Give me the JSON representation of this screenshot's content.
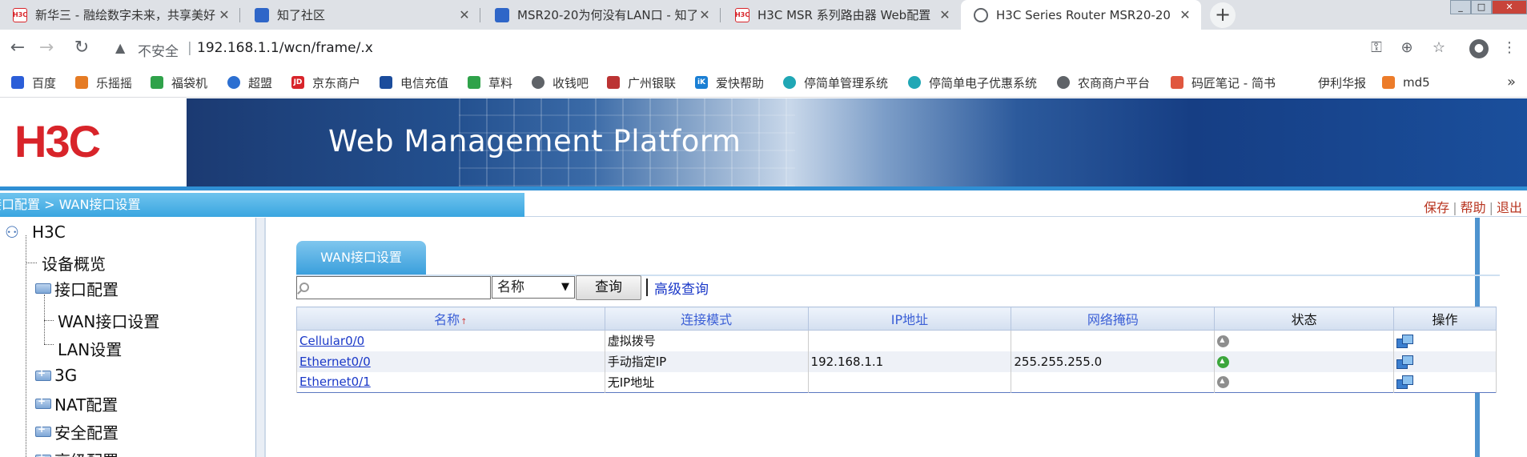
{
  "browser": {
    "tabs": [
      {
        "title": "新华三 - 融绘数字未来，共享美好",
        "fav": "H3C",
        "fav_color": "#d8242a"
      },
      {
        "title": "知了社区",
        "fav": "",
        "fav_color": "#2f66c8"
      },
      {
        "title": "MSR20-20为何没有LAN口 - 知了",
        "fav": "",
        "fav_color": "#2f66c8"
      },
      {
        "title": "H3C MSR 系列路由器 Web配置",
        "fav": "H3C",
        "fav_color": "#d8242a"
      },
      {
        "title": "H3C Series Router MSR20-20",
        "fav": "",
        "fav_color": "#5f6368"
      }
    ],
    "new_tab": "+",
    "window_controls": {
      "minimize": "_",
      "maximize": "□",
      "close": "✕"
    }
  },
  "address_bar": {
    "back": "←",
    "forward": "→",
    "reload": "↻",
    "warning": "▲",
    "security": "不安全",
    "separator": "|",
    "url": "192.168.1.1/wcn/frame/.x",
    "icons": [
      "key-icon",
      "zoom-icon",
      "star-icon",
      "profile-icon",
      "menu-icon"
    ]
  },
  "bookmarks": [
    {
      "label": "百度",
      "color": "#2b5ed8"
    },
    {
      "label": "乐摇摇",
      "color": "#e57b24"
    },
    {
      "label": "福袋机",
      "color": "#2fa24a"
    },
    {
      "label": "超盟",
      "color": "#2c6fd1"
    },
    {
      "label": "京东商户",
      "color": "#d8242a"
    },
    {
      "label": "电信充值",
      "color": "#1b4c9c"
    },
    {
      "label": "草料",
      "color": "#2fa24a"
    },
    {
      "label": "收钱吧",
      "color": "#5f6368"
    },
    {
      "label": "广州银联",
      "color": "#b33"
    },
    {
      "label": "爱快帮助",
      "color": "#1a7fd4"
    },
    {
      "label": "停简单管理系统",
      "color": "#20a7b5"
    },
    {
      "label": "停简单电子优惠系统",
      "color": "#20a7b5"
    },
    {
      "label": "农商商户平台",
      "color": "#5f6368"
    },
    {
      "label": "码匠笔记 - 简书",
      "color": "#e0573f"
    },
    {
      "label": "伊利华报",
      "color": "#ffffff"
    },
    {
      "label": "md5",
      "color": "#ec7c2a"
    }
  ],
  "bookmarks_more": "»",
  "router": {
    "logo": "H3C",
    "platform_title": "Web Management Platform",
    "breadcrumb": "接口配置 > WAN接口设置",
    "top_links": {
      "save": "保存",
      "help": "帮助",
      "logout": "退出"
    },
    "nav": {
      "root": "H3C",
      "overview": "设备概览",
      "interface_config": "接口配置",
      "wan": "WAN接口设置",
      "lan": "LAN设置",
      "g3": "3G",
      "nat": "NAT配置",
      "security": "安全配置",
      "advanced": "高级配置"
    },
    "panel_tab": "WAN接口设置",
    "search": {
      "placeholder": "",
      "field_selected": "名称",
      "query_button": "查询",
      "advanced_link": "高级查询"
    },
    "table": {
      "headers": [
        "名称",
        "连接模式",
        "IP地址",
        "网络掩码",
        "状态",
        "操作"
      ],
      "sort_marker": "↑",
      "rows": [
        {
          "name": "Cellular0/0",
          "mode": "虚拟拨号",
          "ip": "",
          "mask": "",
          "status": "down"
        },
        {
          "name": "Ethernet0/0",
          "mode": "手动指定IP",
          "ip": "192.168.1.1",
          "mask": "255.255.255.0",
          "status": "up"
        },
        {
          "name": "Ethernet0/1",
          "mode": "无IP地址",
          "ip": "",
          "mask": "",
          "status": "down"
        }
      ]
    }
  }
}
